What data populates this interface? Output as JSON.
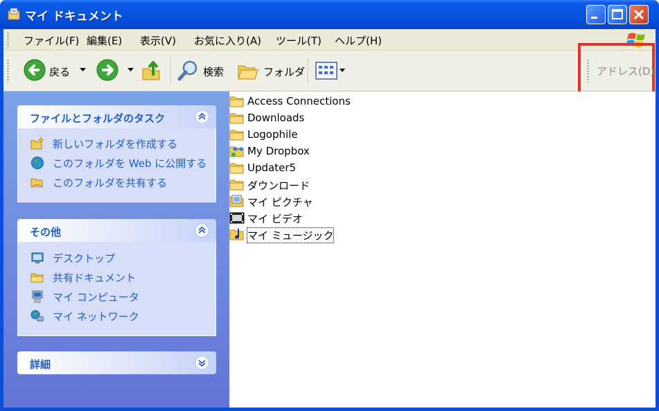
{
  "window": {
    "title": "マイ ドキュメント",
    "colors": {
      "titlebar": "#0755df",
      "frame": "#0a4fd8",
      "close": "#c83a1c",
      "taskpane_link": "#215dc6",
      "highlight": "#e53030"
    }
  },
  "menubar": {
    "items": [
      "ファイル(F)",
      "編集(E)",
      "表示(V)",
      "お気に入り(A)",
      "ツール(T)",
      "ヘルプ(H)"
    ]
  },
  "toolbar": {
    "back": "戻る",
    "search": "検索",
    "folders": "フォルダ",
    "address": "アドレス(D)"
  },
  "tasks_panel": {
    "title": "ファイルとフォルダのタスク",
    "items": [
      {
        "label": "新しいフォルダを作成する",
        "icon": "new-folder-icon"
      },
      {
        "label": "このフォルダを Web に公開する",
        "icon": "globe-icon"
      },
      {
        "label": "このフォルダを共有する",
        "icon": "shared-folder-icon"
      }
    ]
  },
  "other_panel": {
    "title": "その他",
    "items": [
      {
        "label": "デスクトップ",
        "icon": "desktop-icon"
      },
      {
        "label": "共有ドキュメント",
        "icon": "folder-icon"
      },
      {
        "label": "マイ コンピュータ",
        "icon": "computer-icon"
      },
      {
        "label": "マイ ネットワーク",
        "icon": "network-icon"
      }
    ]
  },
  "details_panel": {
    "title": "詳細"
  },
  "files": [
    {
      "name": "Access Connections",
      "icon": "folder-icon"
    },
    {
      "name": "Downloads",
      "icon": "folder-icon"
    },
    {
      "name": "Logophile",
      "icon": "folder-icon"
    },
    {
      "name": "My Dropbox",
      "icon": "dropbox-folder-icon"
    },
    {
      "name": "Updater5",
      "icon": "folder-icon"
    },
    {
      "name": "ダウンロード",
      "icon": "folder-icon"
    },
    {
      "name": "マイ ピクチャ",
      "icon": "pictures-folder-icon"
    },
    {
      "name": "マイ ビデオ",
      "icon": "video-folder-icon"
    },
    {
      "name": "マイ ミュージック",
      "icon": "music-folder-icon"
    }
  ]
}
